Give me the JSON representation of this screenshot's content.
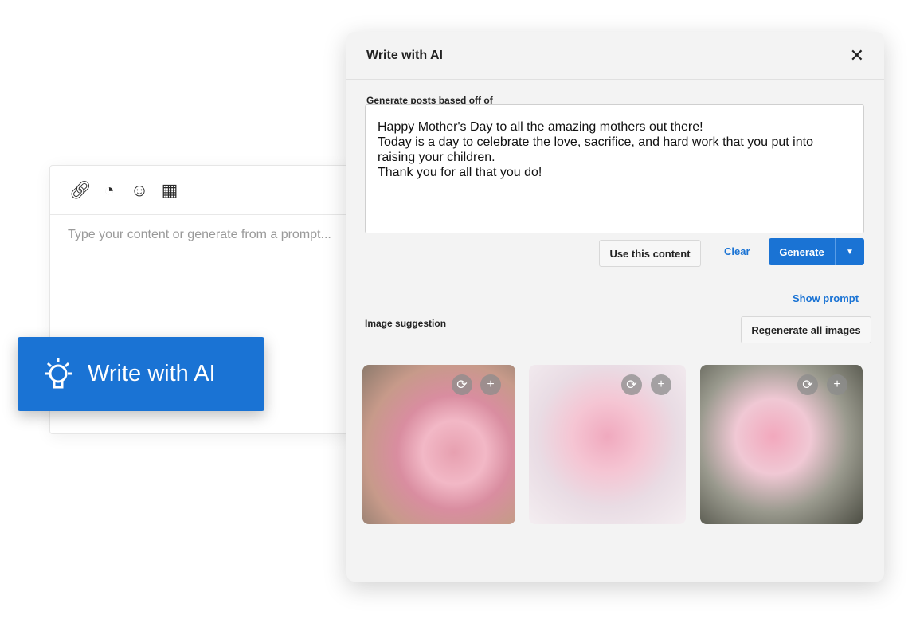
{
  "editor": {
    "toolbar": [
      {
        "icon": "link-icon",
        "glyph": "⛓"
      },
      {
        "icon": "rss-icon",
        "glyph": "◔"
      },
      {
        "icon": "emoji-icon",
        "glyph": "☺"
      },
      {
        "icon": "layout-icon",
        "glyph": "▦"
      }
    ],
    "placeholder": "Type your content or generate from a prompt..."
  },
  "ai_button": {
    "label": "Write with AI",
    "icon": "lightbulb-icon",
    "color": "#1a73d4"
  },
  "dialog": {
    "title": "Write with AI",
    "close": "✕",
    "prompt_label": "Generate posts based off of",
    "prompt_text": "Happy Mother's Day to all the amazing mothers out there!\nToday is a day to celebrate the love, sacrifice, and hard work that you put into raising your children.\nThank you for all that you do!",
    "use_content": "Use this content",
    "clear": "Clear",
    "generate": "Generate",
    "show_prompt": "Show prompt",
    "image_label": "Image suggestion",
    "regenerate_all": "Regenerate all images",
    "images": [
      {
        "alt": "pink ranunculus"
      },
      {
        "alt": "pink gerbera bouquet"
      },
      {
        "alt": "pink flower bouquet"
      }
    ]
  }
}
